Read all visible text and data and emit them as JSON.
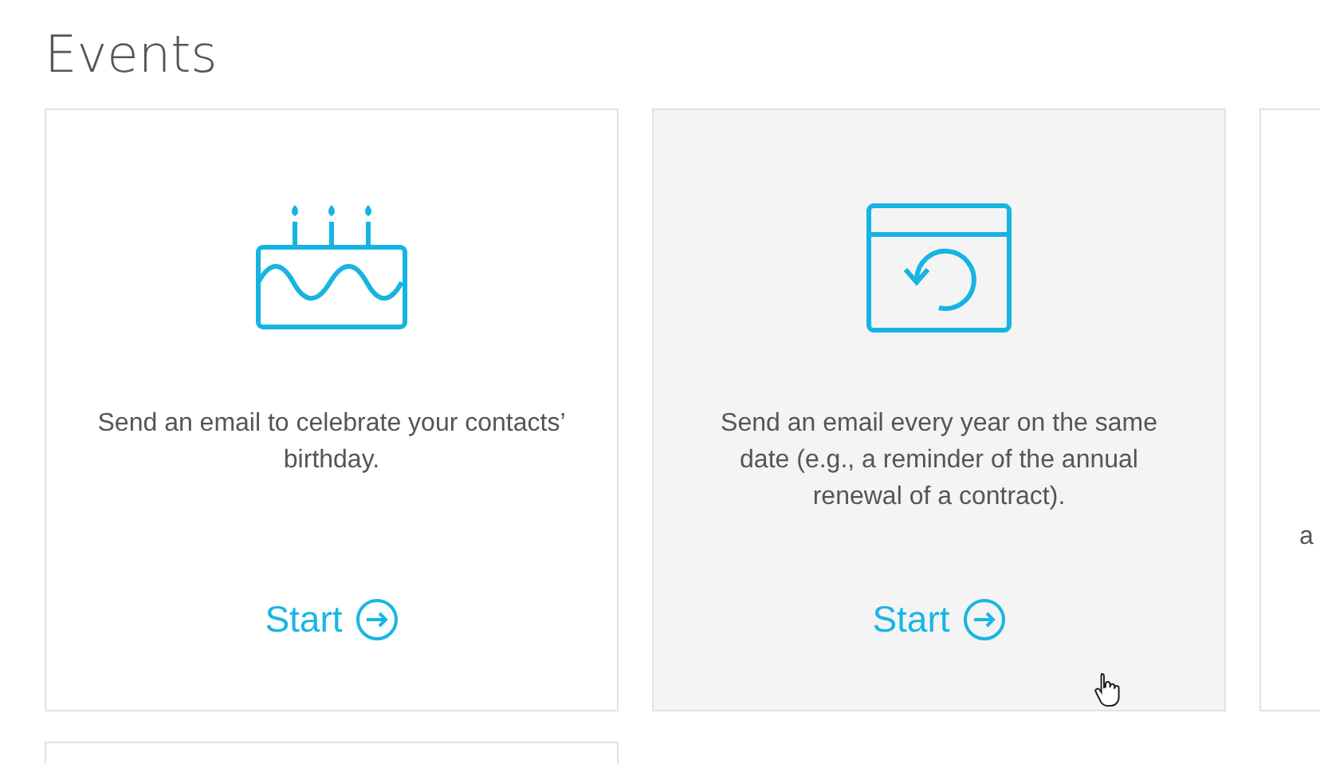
{
  "page": {
    "title": "Events"
  },
  "cards": [
    {
      "kind": "birthday",
      "description": "Send an email to celebrate your contacts’ birthday.",
      "action": "Start",
      "hovered": false
    },
    {
      "kind": "annual",
      "description": "Send an email every year on the same date (e.g., a reminder of the annual renewal of a contract).",
      "action": "Start",
      "hovered": true
    },
    {
      "kind": "partial",
      "description": "a"
    },
    {
      "kind": "empty"
    }
  ]
}
